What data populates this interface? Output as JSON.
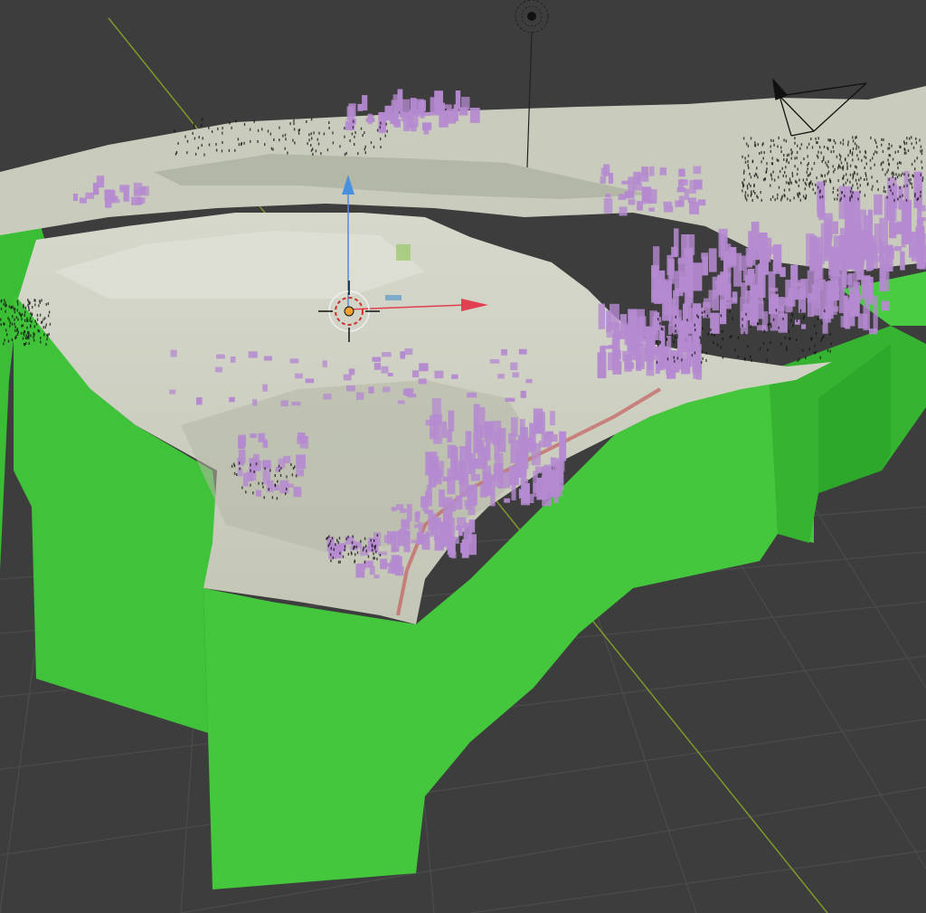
{
  "app": {
    "view": "3D Viewport"
  },
  "colors": {
    "background": "#3d3d3d",
    "grid_line": "#4a4a4a",
    "axis_x_line": "#8a3030",
    "axis_y_line": "#7d9a2a",
    "extrusion": "#3fc03a",
    "extrusion_dark": "#2fa02c",
    "terrain": "#c9cbbb",
    "terrain_shade": "#a8ad9c",
    "buildings": "#b58ad0",
    "gizmo_x": "#e04050",
    "gizmo_z": "#4a90e0",
    "origin_dot": "#f0a030"
  },
  "scene": {
    "objects": [
      {
        "name": "terrain-mesh",
        "icon": "mesh-icon"
      },
      {
        "name": "extruded-base",
        "icon": "mesh-icon"
      },
      {
        "name": "buildings",
        "icon": "mesh-icon"
      },
      {
        "name": "light",
        "icon": "light-icon"
      },
      {
        "name": "camera",
        "icon": "camera-icon"
      }
    ]
  },
  "gizmo": {
    "icons": [
      "move-arrow-x-icon",
      "move-arrow-z-icon",
      "3d-cursor-icon"
    ]
  }
}
